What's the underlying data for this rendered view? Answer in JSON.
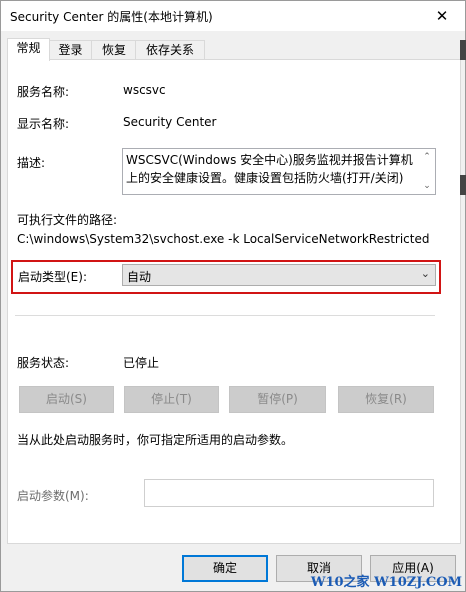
{
  "window": {
    "title": "Security Center 的属性(本地计算机)",
    "close_symbol": "✕"
  },
  "tabs": [
    {
      "label": "常规",
      "active": true
    },
    {
      "label": "登录",
      "active": false
    },
    {
      "label": "恢复",
      "active": false
    },
    {
      "label": "依存关系",
      "active": false
    }
  ],
  "general": {
    "service_name_label": "服务名称:",
    "service_name_value": "wscsvc",
    "display_name_label": "显示名称:",
    "display_name_value": "Security Center",
    "description_label": "描述:",
    "description_value": "WSCSVC(Windows 安全中心)服务监视并报告计算机上的安全健康设置。健康设置包括防火墙(打开/关闭)",
    "path_label": "可执行文件的路径:",
    "path_value": "C:\\windows\\System32\\svchost.exe -k LocalServiceNetworkRestricted",
    "startup_type_label": "启动类型(E):",
    "startup_type_value": "自动",
    "status_label": "服务状态:",
    "status_value": "已停止",
    "start_button": "启动(S)",
    "stop_button": "停止(T)",
    "pause_button": "暂停(P)",
    "resume_button": "恢复(R)",
    "hint_text": "当从此处启动服务时，你可指定所适用的启动参数。",
    "start_params_label": "启动参数(M):",
    "start_params_value": ""
  },
  "footer": {
    "ok_button": "确定",
    "cancel_button": "取消",
    "apply_button": "应用(A)"
  },
  "watermark": "W10之家 W10ZJ.COM",
  "colors": {
    "highlight_border": "#d11414",
    "default_button_border": "#0078d7",
    "watermark": "#1b5bb5"
  }
}
